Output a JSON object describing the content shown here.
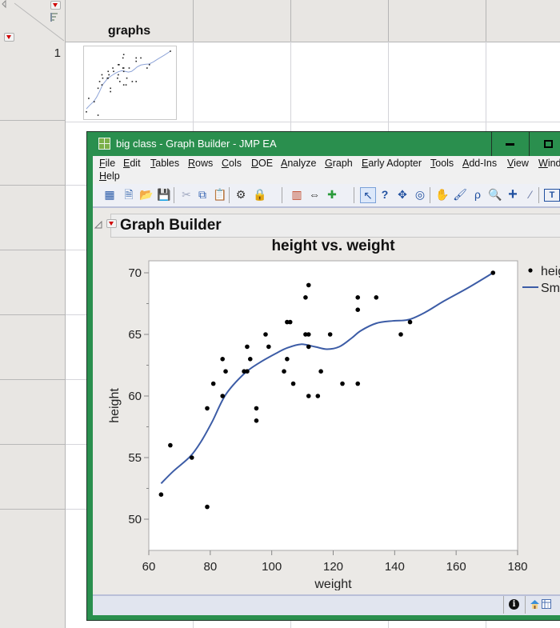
{
  "data_table": {
    "column_header": "graphs",
    "row_number": "1"
  },
  "window": {
    "title": "big class - Graph Builder - JMP EA",
    "minimize_glyph": "–",
    "maximize_glyph": "□",
    "menu": [
      "File",
      "Edit",
      "Tables",
      "Rows",
      "Cols",
      "DOE",
      "Analyze",
      "Graph",
      "Early Adopter",
      "Tools",
      "Add-Ins",
      "View",
      "Wind",
      "Help"
    ],
    "toolbar_icons": [
      "new-data-table-icon",
      "new-script-icon",
      "open-icon",
      "save-icon",
      "cut-icon",
      "copy-icon",
      "paste-icon",
      "data-filter-icon",
      "lock-icon",
      "data-grid-icon",
      "column-switch-icon",
      "add-graphics-icon",
      "arrow-tool-icon",
      "help-tool-icon",
      "selection-tool-icon",
      "crosshair-target-icon",
      "hand-tool-icon",
      "brush-tool-icon",
      "lasso-tool-icon",
      "magnifier-icon",
      "crosshair-icon",
      "ruler-icon",
      "annotate-icon"
    ]
  },
  "report": {
    "outline_title": "Graph Builder"
  },
  "chart_data": {
    "type": "scatter",
    "title": "height vs. weight",
    "xlabel": "weight",
    "ylabel": "height",
    "xlim": [
      60,
      180
    ],
    "ylim": [
      47.5,
      71
    ],
    "xticks": [
      60,
      80,
      100,
      120,
      140,
      160,
      180
    ],
    "yticks": [
      50,
      55,
      60,
      65,
      70
    ],
    "legend": {
      "placement": "right",
      "entries": [
        "height",
        "Smoother"
      ]
    },
    "series": [
      {
        "name": "height",
        "kind": "points",
        "color": "#000000",
        "points": [
          [
            64,
            52
          ],
          [
            67,
            56
          ],
          [
            74,
            55
          ],
          [
            79,
            51
          ],
          [
            79,
            59
          ],
          [
            81,
            61
          ],
          [
            84,
            63
          ],
          [
            84,
            60
          ],
          [
            85,
            62
          ],
          [
            91,
            62
          ],
          [
            92,
            62
          ],
          [
            92,
            64
          ],
          [
            93,
            63
          ],
          [
            95,
            59
          ],
          [
            95,
            58
          ],
          [
            98,
            65
          ],
          [
            99,
            64
          ],
          [
            104,
            62
          ],
          [
            105,
            63
          ],
          [
            105,
            66
          ],
          [
            106,
            66
          ],
          [
            107,
            61
          ],
          [
            111,
            65
          ],
          [
            112,
            65
          ],
          [
            111,
            68
          ],
          [
            112,
            69
          ],
          [
            112,
            64
          ],
          [
            112,
            60
          ],
          [
            115,
            60
          ],
          [
            116,
            62
          ],
          [
            119,
            65
          ],
          [
            123,
            61
          ],
          [
            128,
            68
          ],
          [
            128,
            67
          ],
          [
            128,
            61
          ],
          [
            134,
            68
          ],
          [
            142,
            65
          ],
          [
            145,
            66
          ],
          [
            172,
            70
          ]
        ]
      },
      {
        "name": "Smoother",
        "kind": "line",
        "color": "#3c5ca6",
        "points": [
          [
            64,
            52.9
          ],
          [
            68,
            53.9
          ],
          [
            73.5,
            55.1
          ],
          [
            77,
            56.3
          ],
          [
            80.6,
            57.9
          ],
          [
            85,
            60.1
          ],
          [
            91,
            61.8
          ],
          [
            96,
            62.7
          ],
          [
            101.7,
            63.5
          ],
          [
            105,
            63.9
          ],
          [
            109.5,
            64.2
          ],
          [
            114,
            64.0
          ],
          [
            118,
            63.8
          ],
          [
            122,
            64.0
          ],
          [
            126,
            64.7
          ],
          [
            129,
            65.3
          ],
          [
            134,
            65.9
          ],
          [
            139.5,
            66.1
          ],
          [
            144.6,
            66.2
          ],
          [
            150,
            66.8
          ],
          [
            156,
            67.7
          ],
          [
            164,
            68.8
          ],
          [
            172,
            70.0
          ]
        ]
      }
    ]
  },
  "status_bar": {
    "icons": [
      "info-icon",
      "home-icon",
      "data-table-icon"
    ]
  }
}
